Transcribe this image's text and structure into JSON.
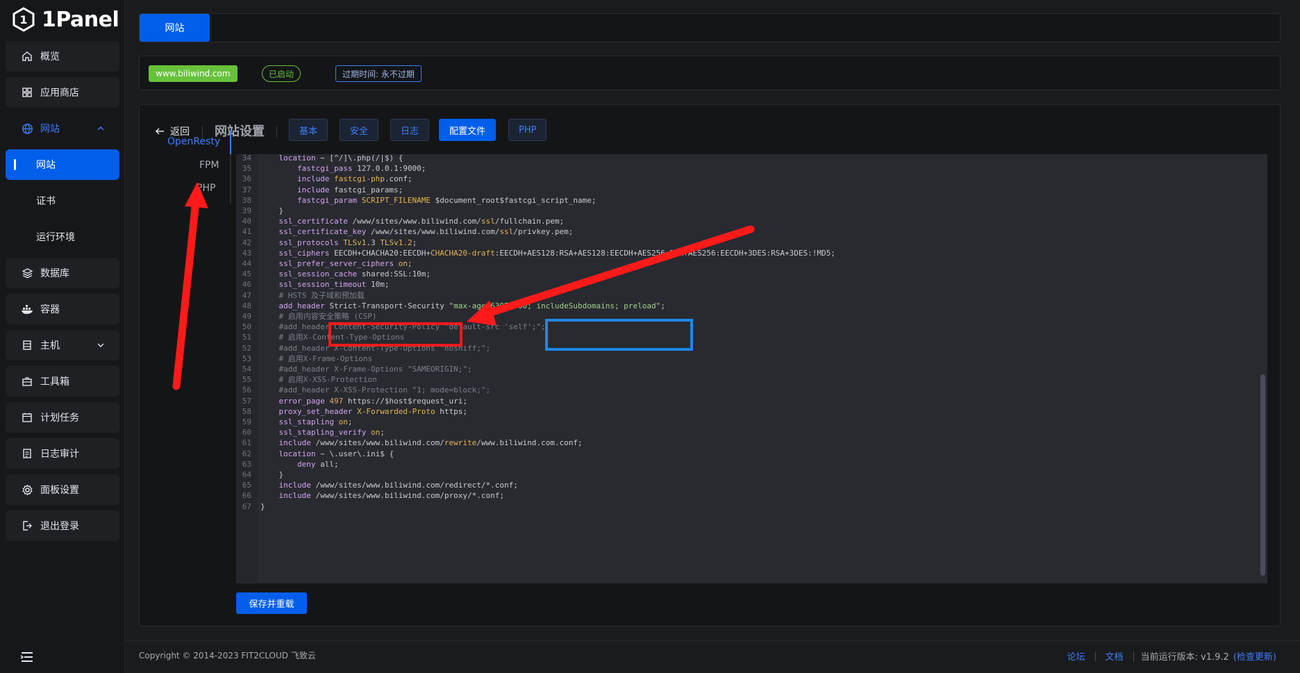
{
  "app": {
    "logo_text": "1Panel"
  },
  "sidebar": {
    "items": [
      {
        "label": "概览",
        "icon": "home-icon"
      },
      {
        "label": "应用商店",
        "icon": "grid-icon"
      },
      {
        "label": "网站",
        "icon": "globe-icon"
      },
      {
        "label": "数据库",
        "icon": "layers-icon"
      },
      {
        "label": "容器",
        "icon": "docker-icon"
      },
      {
        "label": "主机",
        "icon": "server-icon"
      },
      {
        "label": "工具箱",
        "icon": "toolbox-icon"
      },
      {
        "label": "计划任务",
        "icon": "calendar-icon"
      },
      {
        "label": "日志审计",
        "icon": "log-icon"
      },
      {
        "label": "面板设置",
        "icon": "gear-icon"
      },
      {
        "label": "退出登录",
        "icon": "logout-icon"
      }
    ],
    "website_submenu": [
      {
        "label": "网站"
      },
      {
        "label": "证书"
      },
      {
        "label": "运行环境"
      }
    ]
  },
  "tabs": {
    "active": "网站"
  },
  "site": {
    "domain": "www.biliwind.com",
    "status": "已启动",
    "expire": "过期时间: 永不过期"
  },
  "settings": {
    "back": "返回",
    "title": "网站设置",
    "tabs": [
      "基本",
      "安全",
      "日志",
      "配置文件",
      "PHP"
    ],
    "active_tab": "配置文件",
    "side_tabs": [
      "OpenResty",
      "FPM",
      "PHP"
    ],
    "save_button": "保存并重载"
  },
  "editor": {
    "lines": [
      {
        "n": "34",
        "t": "    location ~ [^/]\\.php(/|$) {"
      },
      {
        "n": "35",
        "t": "        fastcgi_pass 127.0.0.1:9000;"
      },
      {
        "n": "36",
        "t": "        include fastcgi-php.conf;"
      },
      {
        "n": "37",
        "t": "        include fastcgi_params;"
      },
      {
        "n": "38",
        "t": "        fastcgi_param SCRIPT_FILENAME $document_root$fastcgi_script_name;"
      },
      {
        "n": "39",
        "t": "    }"
      },
      {
        "n": "40",
        "t": "    ssl_certificate /www/sites/www.biliwind.com/ssl/fullchain.pem;"
      },
      {
        "n": "41",
        "t": "    ssl_certificate_key /www/sites/www.biliwind.com/ssl/privkey.pem;"
      },
      {
        "n": "42",
        "t": "    ssl_protocols TLSv1.3 TLSv1.2;"
      },
      {
        "n": "43",
        "t": "    ssl_ciphers EECDH+CHACHA20:EECDH+CHACHA20-draft:EECDH+AES128:RSA+AES128:EECDH+AES256:RSA+AES256:EECDH+3DES:RSA+3DES:!MD5;"
      },
      {
        "n": "44",
        "t": "    ssl_prefer_server_ciphers on;"
      },
      {
        "n": "45",
        "t": "    ssl_session_cache shared:SSL:10m;"
      },
      {
        "n": "46",
        "t": "    ssl_session_timeout 10m;"
      },
      {
        "n": "47",
        "t": "    # HSTS 及子域和预加载"
      },
      {
        "n": "48",
        "t": "    add_header Strict-Transport-Security \"max-age=63072000; includeSubdomains; preload\";"
      },
      {
        "n": "49",
        "t": "    # 启用内容安全策略 (CSP)"
      },
      {
        "n": "50",
        "t": "    #add_header Content-Security-Policy \"default-src 'self';\";"
      },
      {
        "n": "51",
        "t": "    # 启用X-Content-Type-Options"
      },
      {
        "n": "52",
        "t": "    #add_header X-Content-Type-Options \"nosniff;\";"
      },
      {
        "n": "53",
        "t": "    # 启用X-Frame-Options"
      },
      {
        "n": "54",
        "t": "    #add_header X-Frame-Options \"SAMEORIGIN;\";"
      },
      {
        "n": "55",
        "t": "    # 启用X-XSS-Protection"
      },
      {
        "n": "56",
        "t": "    #add_header X-XSS-Protection \"1; mode=block;\";"
      },
      {
        "n": "57",
        "t": "    error_page 497 https://$host$request_uri;"
      },
      {
        "n": "58",
        "t": "    proxy_set_header X-Forwarded-Proto https;"
      },
      {
        "n": "59",
        "t": "    ssl_stapling on;"
      },
      {
        "n": "60",
        "t": "    ssl_stapling_verify on;"
      },
      {
        "n": "61",
        "t": "    include /www/sites/www.biliwind.com/rewrite/www.biliwind.com.conf;"
      },
      {
        "n": "62",
        "t": "    location ~ \\.user\\.ini$ {"
      },
      {
        "n": "63",
        "t": "        deny all;"
      },
      {
        "n": "64",
        "t": "    }"
      },
      {
        "n": "65",
        "t": "    include /www/sites/www.biliwind.com/redirect/*.conf;"
      },
      {
        "n": "66",
        "t": "    include /www/sites/www.biliwind.com/proxy/*.conf;"
      },
      {
        "n": "67",
        "t": "}"
      }
    ]
  },
  "footer": {
    "copyright": "Copyright © 2014-2023 FIT2CLOUD 飞致云",
    "forum": "论坛",
    "docs": "文档",
    "version_label": "当前运行版本: v1.9.2",
    "check_update": "(检查更新)"
  },
  "colors": {
    "accent": "#005eeb",
    "success": "#67c23a",
    "annotation_red": "#ff1a1a",
    "annotation_blue": "#1f88e5"
  }
}
